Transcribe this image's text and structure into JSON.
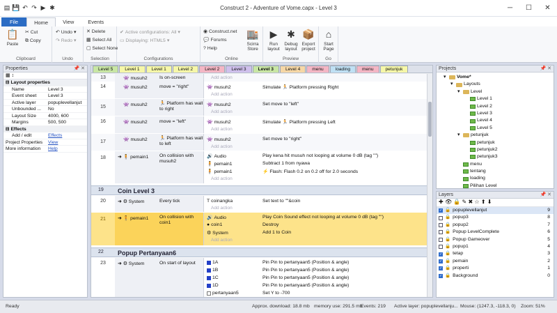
{
  "window": {
    "title": "Construct 2 - Adventure of Vome.capx - Level 3"
  },
  "ribbon_tabs": [
    "File",
    "Home",
    "View",
    "Events"
  ],
  "clipboard": {
    "paste": "Paste",
    "cut": "Cut",
    "copy": "Copy",
    "label": "Clipboard"
  },
  "undo": {
    "undo": "Undo",
    "redo": "Redo",
    "label": "Undo"
  },
  "selection": {
    "delete": "Delete",
    "select_all": "Select All",
    "select_none": "Select None",
    "label": "Selection"
  },
  "configurations": {
    "active": "Active configurations: All",
    "displaying": "Displaying: HTML5",
    "label": "Configurations"
  },
  "online": {
    "cnet": "Construct.net",
    "forums": "Forums",
    "help": "Help",
    "store": "Scirra Store",
    "label": "Online"
  },
  "preview": {
    "run": "Run layout",
    "debug": "Debug layout",
    "export": "Export project",
    "label": "Preview"
  },
  "go": {
    "start": "Start Page",
    "label": "Go"
  },
  "properties": {
    "title": "Properties",
    "section1": "Layout properties",
    "rows": [
      [
        "Name",
        "Level 3"
      ],
      [
        "Event sheet",
        "Level 3"
      ],
      [
        "Active layer",
        "popuplevellanjut"
      ],
      [
        "Unbounded ...",
        "No"
      ],
      [
        "Layout Size",
        "4000, 600"
      ],
      [
        "Margins",
        "500, 500"
      ]
    ],
    "section2": "Effects",
    "add_edit": "Add / edit",
    "effects_link": "Effects",
    "project_props": "Project Properties",
    "view_link": "View",
    "more_info": "More information",
    "help_link": "Help"
  },
  "layout_tabs": [
    "Level 5",
    "Level 1",
    "Level 1",
    "Level 2",
    "Level 2",
    "Level 3",
    "Level 3",
    "Level 4",
    "menu",
    "loading",
    "menu",
    "petunjuk"
  ],
  "layout_tab_colors": [
    "#c8e6a4",
    "#f6f7a8",
    "#f6f7a8",
    "#f6f7a8",
    "#f4b6c4",
    "#cfc0ec",
    "#c8e6a4",
    "#f6d7a6",
    "#f4b6c4",
    "#bfe0f4",
    "#f4b6c4",
    "#f6f7a8"
  ],
  "events": {
    "e13": {
      "num": "13",
      "obj": "musuh2",
      "cond": "Is on-screen"
    },
    "e14": {
      "num": "14",
      "obj": "musuh2",
      "cond": "move = \"right\"",
      "aobj": "musuh2",
      "act": "Simulate 🏃 Platform pressing Right"
    },
    "e15": {
      "num": "15",
      "obj": "musuh2",
      "cond": "🏃 Platform has wall to right",
      "aobj": "musuh2",
      "act": "Set move to \"left\""
    },
    "e16": {
      "num": "16",
      "obj": "musuh2",
      "cond": "move = \"left\"",
      "aobj": "musuh2",
      "act": "Simulate 🏃 Platform pressing Left"
    },
    "e17": {
      "num": "17",
      "obj": "musuh2",
      "cond": "🏃 Platform has wall to left",
      "aobj": "musuh2",
      "act": "Set move to \"right\""
    },
    "e18": {
      "num": "18",
      "obj": "pemain1",
      "cond": "On collision with musuh2",
      "a1o": "Audio",
      "a1": "Play kena hit musuh not looping at volume 0 dB (tag \"\")",
      "a2o": "pemain1",
      "a2": "Subtract 1 from nyawa",
      "a3o": "pemain1",
      "a3": "⚡ Flash: Flash 0.2 on 0.2 off for 2.0 seconds"
    },
    "g19": {
      "num": "19",
      "title": "Coin Level 3"
    },
    "e20": {
      "num": "20",
      "obj": "System",
      "cond": "Every tick",
      "aobj": "coinangka",
      "act": "Set text to \"\"&coin"
    },
    "e21": {
      "num": "21",
      "obj": "pemain1",
      "cond": "On collision with coin1",
      "a1o": "Audio",
      "a1": "Play Coin Sound effect not looping at volume 0 dB (tag \"\")",
      "a2o": "coin1",
      "a2": "Destroy",
      "a3o": "System",
      "a3": "Add 1 to Coin"
    },
    "g22": {
      "num": "22",
      "title": "Popup Pertanyaan6"
    },
    "e23": {
      "num": "23",
      "obj": "System",
      "cond": "On start of layout",
      "a1o": "1A",
      "a1": "Pin Pin to pertanyaan5 (Position & angle)",
      "a2o": "1B",
      "a2": "Pin Pin to pertanyaan5 (Position & angle)",
      "a3o": "1C",
      "a3": "Pin Pin to pertanyaan5 (Position & angle)",
      "a4o": "1D",
      "a4": "Pin Pin to pertanyaan5 (Position & angle)",
      "a5o": "pertanyaan5",
      "a5": "Set Y to -700"
    },
    "add_action": "Add action"
  },
  "projects": {
    "title": "Projects",
    "items": [
      "Vome*",
      "Layouts",
      "Level",
      "Level 1",
      "Level 2",
      "Level 3",
      "Level 4",
      "Level 5",
      "petunjuk",
      "petunjuk",
      "petunjuk2",
      "petunjuk3",
      "menu",
      "tentang",
      "loading",
      "Pilihan Level"
    ]
  },
  "layers": {
    "title": "Layers",
    "items": [
      {
        "name": "popuplevellanjut",
        "num": "9",
        "checked": true
      },
      {
        "name": "popup3",
        "num": "8",
        "checked": false
      },
      {
        "name": "popup2",
        "num": "7",
        "checked": false
      },
      {
        "name": "Popup LevelComplete",
        "num": "6",
        "checked": false
      },
      {
        "name": "Popup Gameover",
        "num": "5",
        "checked": false
      },
      {
        "name": "popup1",
        "num": "4",
        "checked": false
      },
      {
        "name": "tetap",
        "num": "3",
        "checked": true
      },
      {
        "name": "pemain",
        "num": "2",
        "checked": true
      },
      {
        "name": "properti",
        "num": "1",
        "checked": true
      },
      {
        "name": "Background",
        "num": "0",
        "checked": true
      }
    ]
  },
  "status": {
    "ready": "Ready",
    "download": "Approx. download: 18.8 mb",
    "memory": "memory use: 291.5 mb",
    "events": "Events: 219",
    "active_layer": "Active layer: popuplevellanju...",
    "mouse": "Mouse: (1247.3, -118.3, 0)",
    "zoom": "Zoom: 51%"
  }
}
